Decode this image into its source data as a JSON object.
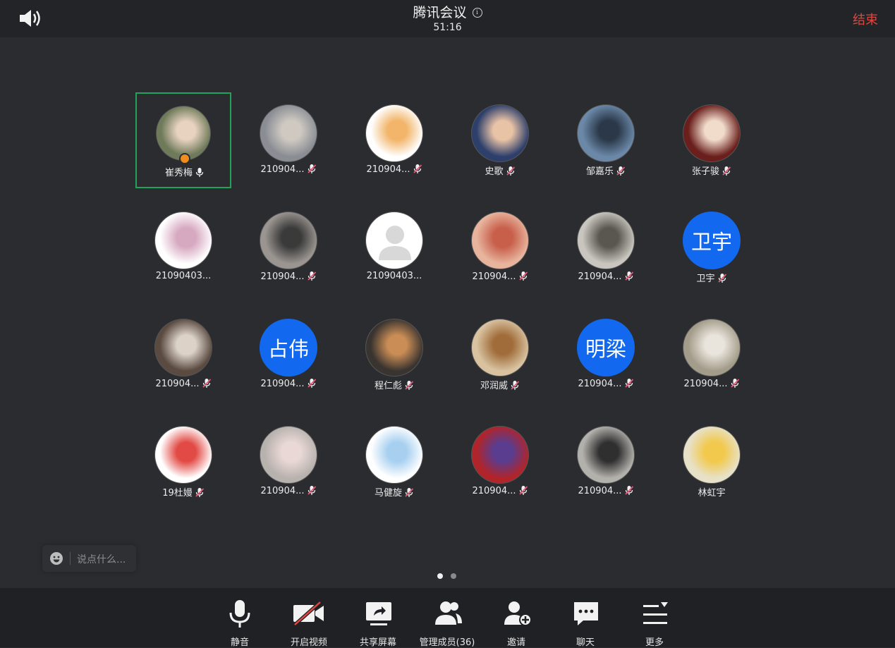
{
  "header": {
    "title": "腾讯会议",
    "timer": "51:16",
    "end_label": "结束"
  },
  "participants": [
    {
      "name": "崔秀梅",
      "mic": "on",
      "active": true,
      "host": true,
      "avatar": {
        "type": "photo",
        "colors": [
          "#6f7a5a",
          "#e8d3c0"
        ]
      }
    },
    {
      "name": "210904...",
      "mic": "muted",
      "avatar": {
        "type": "photo",
        "colors": [
          "#8a8e94",
          "#cfc9c2"
        ]
      }
    },
    {
      "name": "210904...",
      "mic": "muted",
      "avatar": {
        "type": "photo",
        "colors": [
          "#ffffff",
          "#f2b56a"
        ]
      }
    },
    {
      "name": "史歌",
      "mic": "muted",
      "avatar": {
        "type": "photo",
        "colors": [
          "#2d3f6b",
          "#e9c3a6"
        ]
      }
    },
    {
      "name": "邹嘉乐",
      "mic": "muted",
      "avatar": {
        "type": "photo",
        "colors": [
          "#6b88a8",
          "#2a3848"
        ]
      }
    },
    {
      "name": "张子骏",
      "mic": "muted",
      "avatar": {
        "type": "photo",
        "colors": [
          "#6a1f1c",
          "#f1dccc"
        ]
      }
    },
    {
      "name": "21090403...",
      "mic": "none",
      "avatar": {
        "type": "photo",
        "colors": [
          "#ffffff",
          "#d7a9c1"
        ]
      }
    },
    {
      "name": "210904...",
      "mic": "muted",
      "avatar": {
        "type": "photo",
        "colors": [
          "#9a9590",
          "#3a3a3a"
        ]
      }
    },
    {
      "name": "21090403...",
      "mic": "none",
      "avatar": {
        "type": "placeholder",
        "colors": [
          "#ffffff",
          "#d8d8d8"
        ]
      }
    },
    {
      "name": "210904...",
      "mic": "muted",
      "avatar": {
        "type": "photo",
        "colors": [
          "#e8b49d",
          "#c75f4b"
        ]
      }
    },
    {
      "name": "210904...",
      "mic": "muted",
      "avatar": {
        "type": "photo",
        "colors": [
          "#c9c6c0",
          "#5a5750"
        ]
      }
    },
    {
      "name": "卫宇",
      "mic": "muted",
      "avatar": {
        "type": "text",
        "text": "卫宇"
      }
    },
    {
      "name": "210904...",
      "mic": "muted",
      "avatar": {
        "type": "photo",
        "colors": [
          "#5a4a40",
          "#dcd2c8"
        ]
      }
    },
    {
      "name": "210904...",
      "mic": "muted",
      "avatar": {
        "type": "text",
        "text": "占伟"
      }
    },
    {
      "name": "程仁彪",
      "mic": "muted",
      "avatar": {
        "type": "photo",
        "colors": [
          "#3a3430",
          "#c98d55"
        ]
      }
    },
    {
      "name": "邓润威",
      "mic": "muted",
      "avatar": {
        "type": "photo",
        "colors": [
          "#d8c2a0",
          "#a06c3a"
        ]
      }
    },
    {
      "name": "210904...",
      "mic": "muted",
      "avatar": {
        "type": "text",
        "text": "明梁"
      }
    },
    {
      "name": "210904...",
      "mic": "muted",
      "avatar": {
        "type": "photo",
        "colors": [
          "#a39c8a",
          "#e9e4dc"
        ]
      }
    },
    {
      "name": "19杜嫚",
      "mic": "muted",
      "avatar": {
        "type": "photo",
        "colors": [
          "#ffffff",
          "#e24a45"
        ]
      }
    },
    {
      "name": "210904...",
      "mic": "muted",
      "avatar": {
        "type": "photo",
        "colors": [
          "#b8b2ae",
          "#e9d8d6"
        ]
      }
    },
    {
      "name": "马健旋",
      "mic": "muted",
      "avatar": {
        "type": "photo",
        "colors": [
          "#ffffff",
          "#a7d0f0"
        ]
      }
    },
    {
      "name": "210904...",
      "mic": "muted",
      "avatar": {
        "type": "photo",
        "colors": [
          "#b0242a",
          "#5a3d8f"
        ]
      }
    },
    {
      "name": "210904...",
      "mic": "muted",
      "avatar": {
        "type": "photo",
        "colors": [
          "#b3b1ac",
          "#2f2f2f"
        ]
      }
    },
    {
      "name": "林虹宇",
      "mic": "none",
      "avatar": {
        "type": "photo",
        "colors": [
          "#e7e1c8",
          "#f2c94c"
        ]
      }
    }
  ],
  "chat_input": {
    "placeholder": "说点什么..."
  },
  "pager": {
    "pages": 2,
    "current": 1
  },
  "toolbar": {
    "items": [
      {
        "id": "mute",
        "label": "静音",
        "icon": "microphone-icon"
      },
      {
        "id": "video",
        "label": "开启视频",
        "icon": "video-off-icon"
      },
      {
        "id": "share",
        "label": "共享屏幕",
        "icon": "share-screen-icon"
      },
      {
        "id": "members",
        "label": "管理成员(36)",
        "icon": "members-icon"
      },
      {
        "id": "invite",
        "label": "邀请",
        "icon": "invite-user-icon"
      },
      {
        "id": "chat",
        "label": "聊天",
        "icon": "chat-icon"
      },
      {
        "id": "more",
        "label": "更多",
        "icon": "more-menu-icon"
      }
    ]
  },
  "colors": {
    "background": "#2b2c30",
    "end": "#e0463e",
    "active_border": "#22a35a",
    "text_avatar": "#1269ef",
    "muted_icon": "#e5577b"
  }
}
